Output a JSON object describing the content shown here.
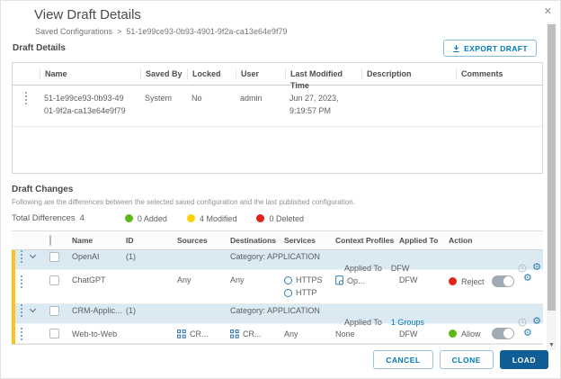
{
  "dialog": {
    "title": "View Draft Details",
    "close_icon": "✕"
  },
  "breadcrumb": {
    "parent": "Saved Configurations",
    "separator": ">",
    "current": "51-1e99ce93-0b93-4901-9f2a-ca13e64e9f79"
  },
  "colors": {
    "accent": "#0079b8",
    "primary_button": "#115d96"
  },
  "draft_details": {
    "heading": "Draft Details",
    "export_button_label": "EXPORT DRAFT",
    "columns": [
      "Name",
      "Saved By",
      "Locked",
      "User",
      "Last Modified Time",
      "Description",
      "Comments"
    ],
    "row": {
      "name": "51-1e99ce93-0b93-4901-9f2a-ca13e64e9f79",
      "saved_by": "System",
      "locked": "No",
      "user": "admin",
      "last_modified_time": "Jun 27, 2023, 9:19:57 PM",
      "description": "",
      "comments": ""
    }
  },
  "draft_changes": {
    "heading": "Draft Changes",
    "subtitle": "Following are the differences between the selected saved configuration and the last published configuration.",
    "total_differences_label": "Total Differences",
    "total_differences_value": "4",
    "modified_bar_color": "#fbc21a",
    "legend": [
      {
        "label": "0 Added",
        "color": "#61b715"
      },
      {
        "label": "4 Modified",
        "color": "#fdd006"
      },
      {
        "label": "0 Deleted",
        "color": "#e2231a"
      }
    ],
    "columns": [
      "Name",
      "ID",
      "Sources",
      "Destinations",
      "Services",
      "Context Profiles",
      "Applied To",
      "Action"
    ],
    "groups": [
      {
        "name": "OpenAI",
        "count": "(1)",
        "category": "Category: APPLICATION",
        "applied_to_label": "Applied To",
        "applied_to_value": "DFW",
        "rules": [
          {
            "name": "ChatGPT",
            "sources": "Any",
            "destinations": "Any",
            "services": [
              "HTTPS",
              "HTTP"
            ],
            "context_profiles": "Op...",
            "applied_to": "DFW",
            "action": "Reject",
            "action_color": "#e2231a"
          }
        ]
      },
      {
        "name": "CRM-Applic...",
        "count": "(1)",
        "category": "Category: APPLICATION",
        "applied_to_label": "Applied To",
        "applied_to_value": "1 Groups",
        "rules": [
          {
            "name": "Web-to-Web",
            "sources": "CR...",
            "destinations": "CR...",
            "services": "Any",
            "context_profiles": "None",
            "applied_to": "DFW",
            "action": "Allow",
            "action_color": "#61b715"
          }
        ]
      }
    ]
  },
  "footer": {
    "cancel_label": "CANCEL",
    "clone_label": "CLONE",
    "load_label": "LOAD"
  }
}
